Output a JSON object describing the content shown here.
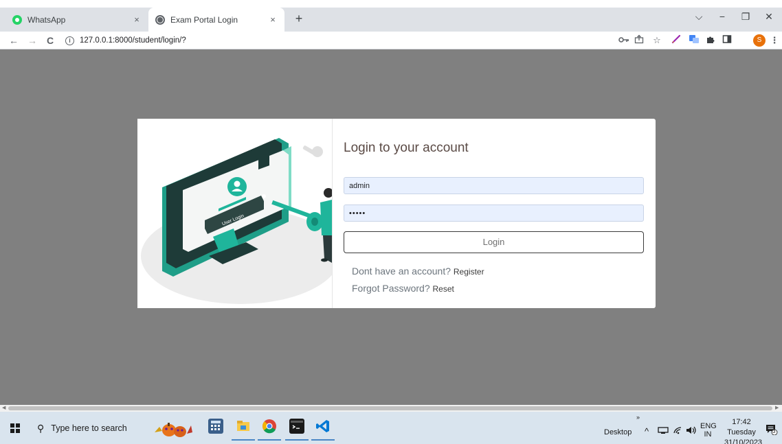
{
  "browser": {
    "tabs": [
      {
        "title": "WhatsApp",
        "close": "×"
      },
      {
        "title": "Exam Portal Login",
        "close": "×"
      }
    ],
    "new_tab": "+",
    "window_controls": {
      "dropdown": "⌵",
      "minimize": "−",
      "maximize": "❐",
      "close": "✕"
    },
    "nav": {
      "back": "←",
      "forward": "→",
      "reload": "C"
    },
    "url": "127.0.0.1:8000/student/login/?",
    "profile_initial": "S"
  },
  "login": {
    "title": "Login to your account",
    "username_value": "admin",
    "password_value": "•••••",
    "login_button": "Login",
    "no_account_text": "Dont have an account?",
    "register_link": "Register",
    "forgot_text": "Forgot Password?",
    "reset_link": "Reset"
  },
  "illustration": {
    "screen_label": "User Login"
  },
  "taskbar": {
    "search_placeholder": "Type here to search",
    "desktop_label": "Desktop",
    "chevrons": "»",
    "language_top": "ENG",
    "language_bottom": "IN",
    "time": "17:42",
    "day": "Tuesday",
    "date": "31/10/2023",
    "notification_count": "3"
  },
  "colors": {
    "page_background": "#808080",
    "illustration_accent": "#1fb59b",
    "taskbar": "#d9e4ee"
  }
}
